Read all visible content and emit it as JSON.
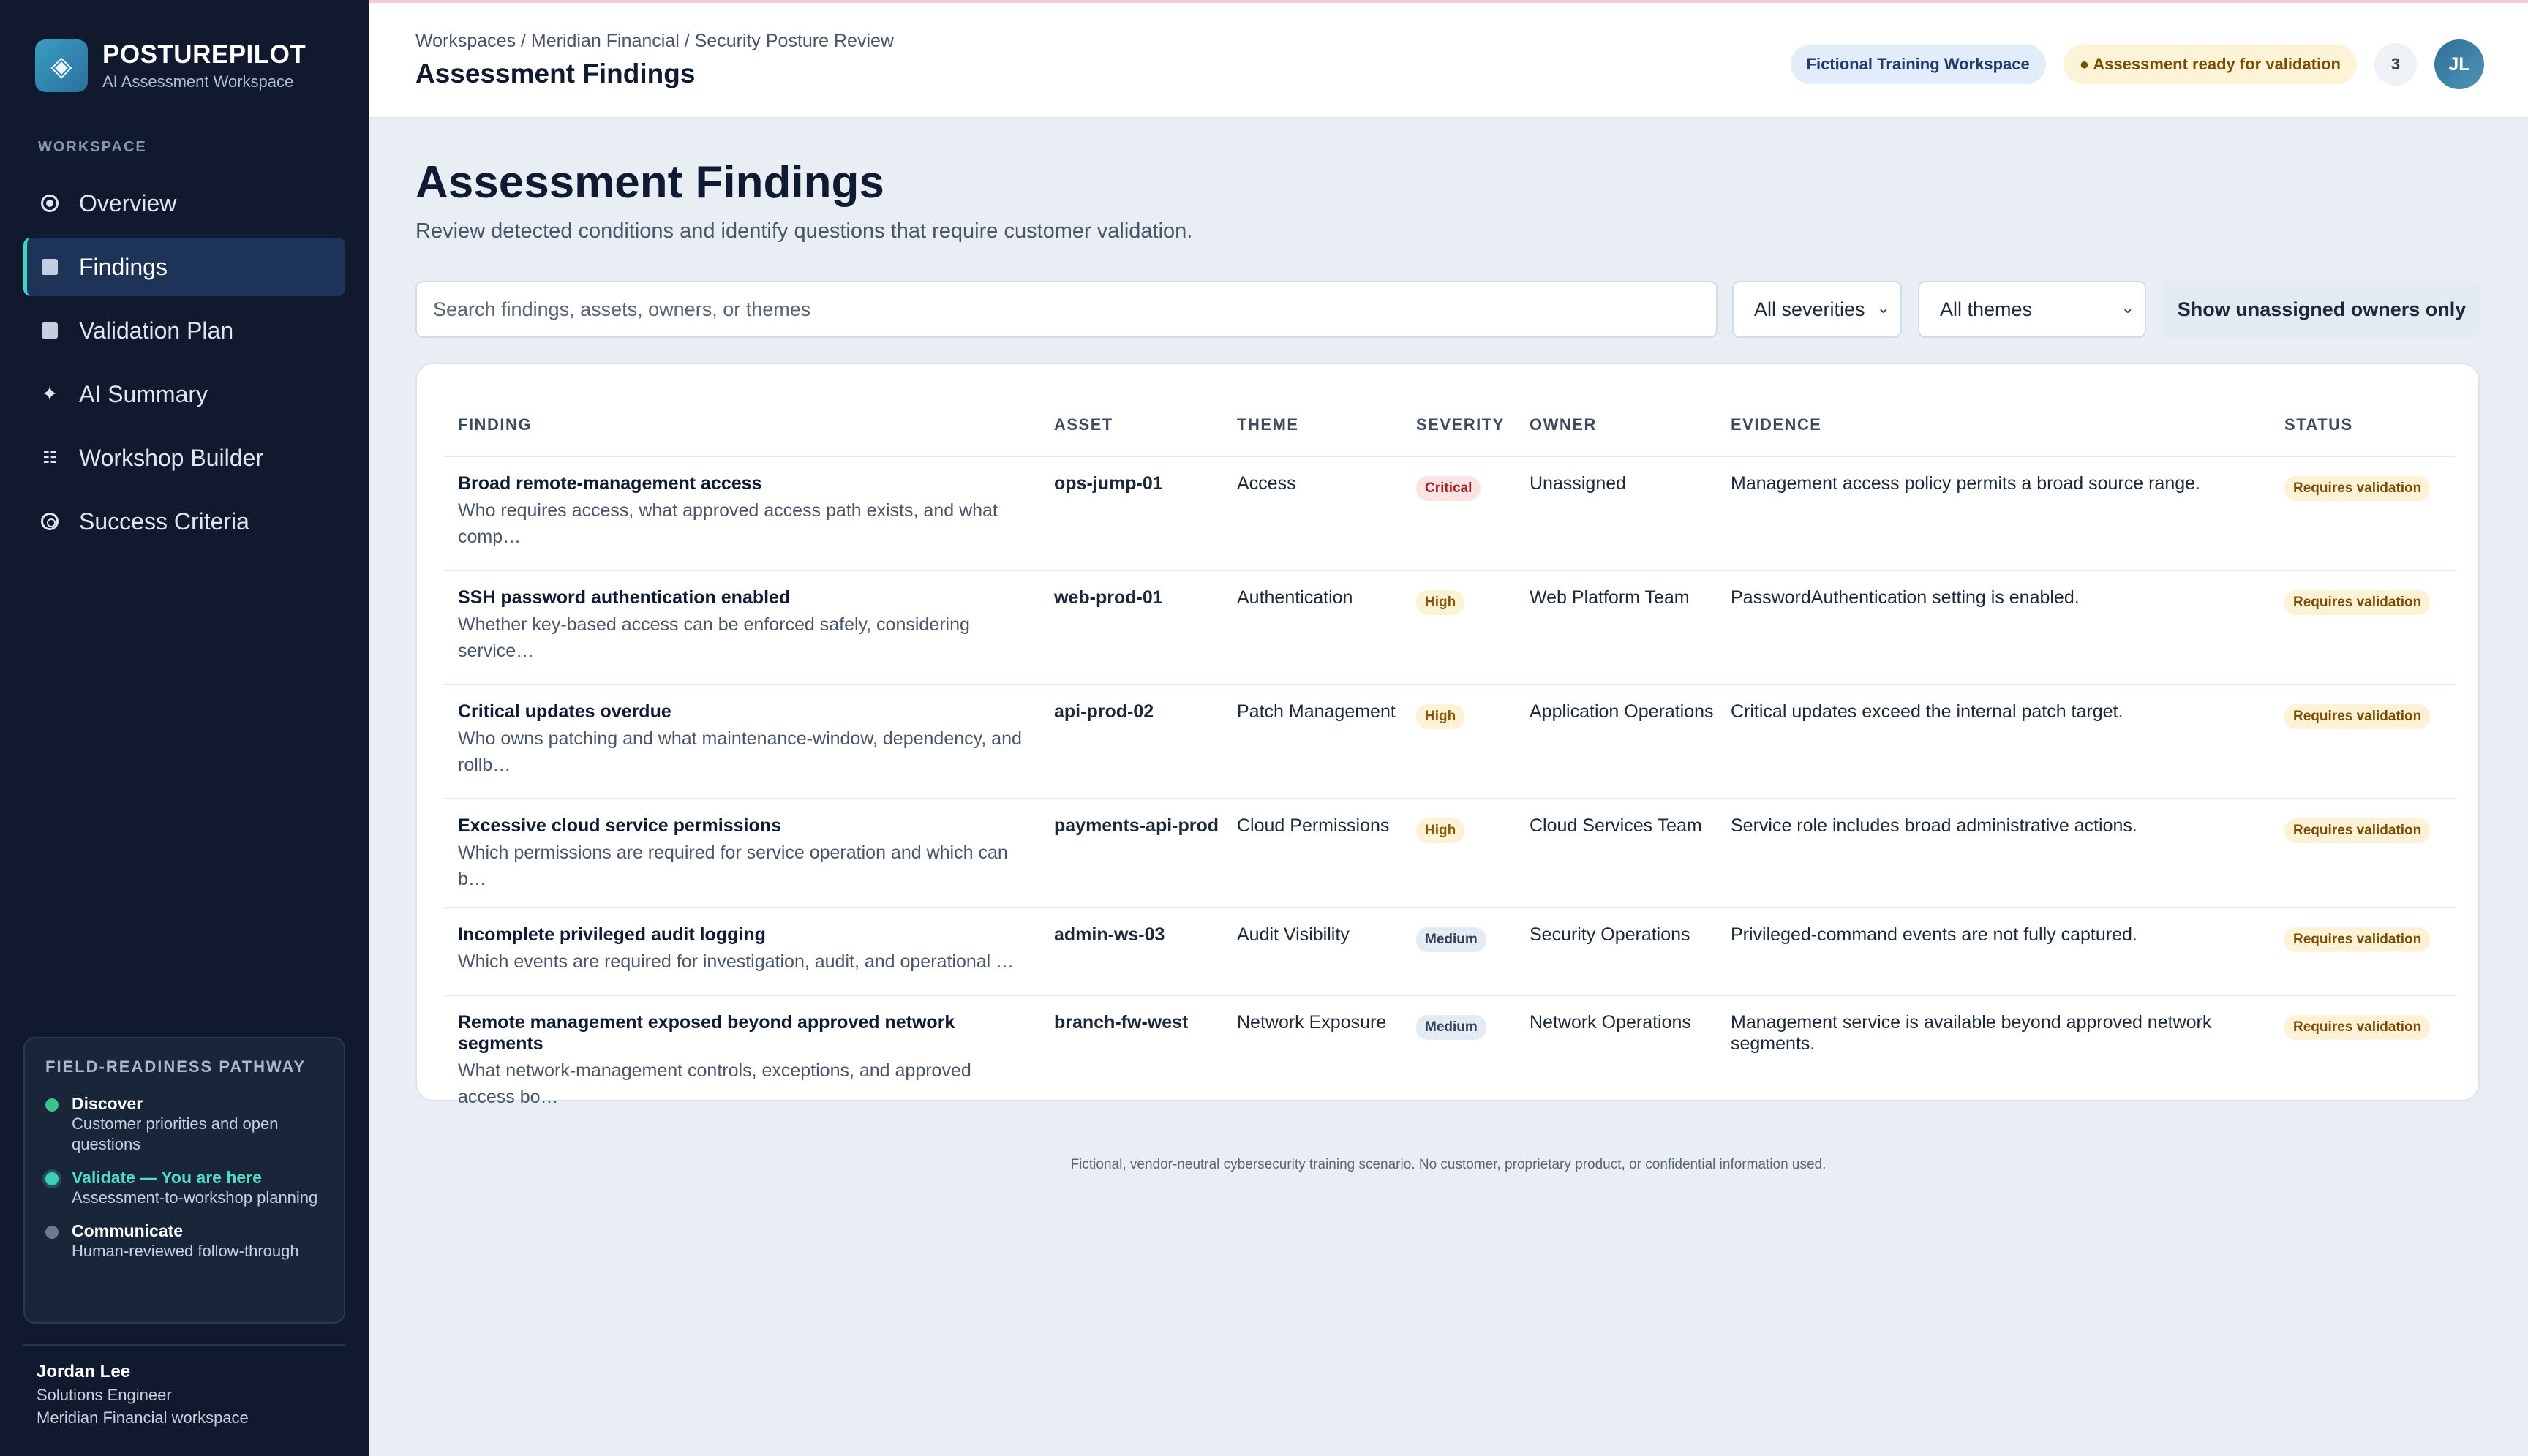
{
  "brand": {
    "name": "POSTUREPILOT",
    "subtitle": "AI Assessment Workspace"
  },
  "sidebar": {
    "heading": "WORKSPACE",
    "items": [
      {
        "label": "Overview",
        "icon": "overview-icon"
      },
      {
        "label": "Findings",
        "icon": "findings-icon",
        "active": true
      },
      {
        "label": "Validation Plan",
        "icon": "validation-plan-icon"
      },
      {
        "label": "AI Summary",
        "icon": "sparkle-icon"
      },
      {
        "label": "Workshop Builder",
        "icon": "grid-icon"
      },
      {
        "label": "Success Criteria",
        "icon": "target-icon"
      }
    ],
    "pathway": {
      "title": "FIELD-READINESS PATHWAY",
      "steps": [
        {
          "title": "Discover",
          "desc": "Customer priorities and open questions",
          "state": "done"
        },
        {
          "title": "Validate — You are here",
          "desc": "Assessment-to-workshop planning",
          "state": "current"
        },
        {
          "title": "Communicate",
          "desc": "Human-reviewed follow-through",
          "state": "todo"
        }
      ]
    },
    "user": {
      "name": "Jordan Lee",
      "role": "Solutions Engineer",
      "workspace": "Meridian Financial workspace"
    }
  },
  "header": {
    "breadcrumb": "Workspaces / Meridian Financial / Security Posture Review",
    "title": "Assessment Findings",
    "workspace_pill": "Fictional Training Workspace",
    "status_pill": "● Assessment ready for validation",
    "count": "3",
    "avatar_initials": "JL"
  },
  "main": {
    "title": "Assessment Findings",
    "subtitle": "Review detected conditions and identify questions that require customer validation.",
    "search_placeholder": "Search findings, assets, owners, or themes",
    "severity_filter": "All severities",
    "theme_filter": "All themes",
    "unassigned_toggle": "Show unassigned owners only",
    "columns": [
      "FINDING",
      "ASSET",
      "THEME",
      "SEVERITY",
      "OWNER",
      "EVIDENCE",
      "STATUS"
    ],
    "rows": [
      {
        "title": "Broad remote-management access",
        "desc": "Who requires access, what approved access path exists, and what comp…",
        "asset": "ops-jump-01",
        "theme": "Access",
        "severity": "Critical",
        "owner": "Unassigned",
        "evidence": "Management access policy permits a broad source range.",
        "status": "Requires validation"
      },
      {
        "title": "SSH password authentication enabled",
        "desc": "Whether key-based access can be enforced safely, considering service…",
        "asset": "web-prod-01",
        "theme": "Authentication",
        "severity": "High",
        "owner": "Web Platform Team",
        "evidence": "PasswordAuthentication setting is enabled.",
        "status": "Requires validation"
      },
      {
        "title": "Critical updates overdue",
        "desc": "Who owns patching and what maintenance-window, dependency, and rollb…",
        "asset": "api-prod-02",
        "theme": "Patch Management",
        "severity": "High",
        "owner": "Application Operations",
        "evidence": "Critical updates exceed the internal patch target.",
        "status": "Requires validation"
      },
      {
        "title": "Excessive cloud service permissions",
        "desc": "Which permissions are required for service operation and which can b…",
        "asset": "payments-api-prod",
        "theme": "Cloud Permissions",
        "severity": "High",
        "owner": "Cloud Services Team",
        "evidence": "Service role includes broad administrative actions.",
        "status": "Requires validation"
      },
      {
        "title": "Incomplete privileged audit logging",
        "desc": "Which events are required for investigation, audit, and operational …",
        "asset": "admin-ws-03",
        "theme": "Audit Visibility",
        "severity": "Medium",
        "owner": "Security Operations",
        "evidence": "Privileged-command events are not fully captured.",
        "status": "Requires validation"
      },
      {
        "title": "Remote management exposed beyond approved network segments",
        "desc": "What network-management controls, exceptions, and approved access bo…",
        "asset": "branch-fw-west",
        "theme": "Network Exposure",
        "severity": "Medium",
        "owner": "Network Operations",
        "evidence": "Management service is available beyond approved network segments.",
        "status": "Requires validation"
      }
    ],
    "footer": "Fictional, vendor-neutral cybersecurity training scenario. No customer, proprietary product, or confidential information used."
  }
}
